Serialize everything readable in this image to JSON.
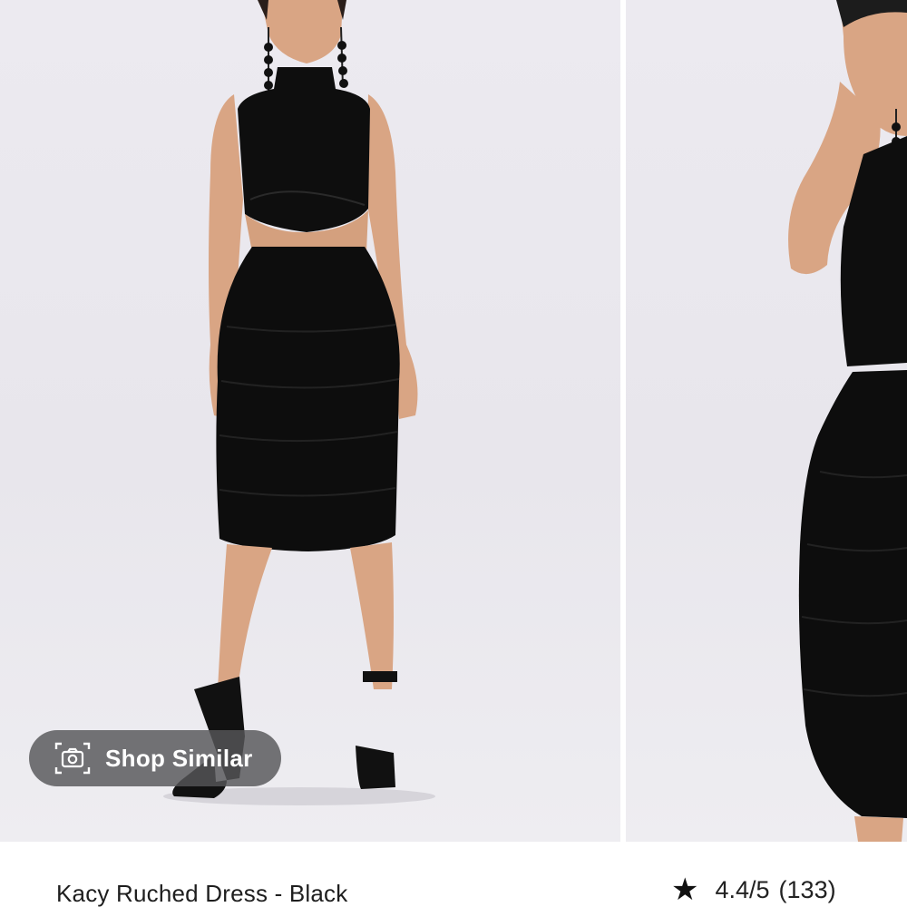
{
  "gallery": {
    "images": [
      {
        "alt": "model-front-view-icon"
      },
      {
        "alt": "model-side-view-icon"
      }
    ],
    "shop_similar": {
      "label": "Shop Similar",
      "icon": "camera-icon"
    }
  },
  "product": {
    "name": "Kacy Ruched Dress - Black",
    "rating": {
      "icon": "star-icon",
      "score": "4.4/5",
      "count": "(133)"
    }
  },
  "colors": {
    "background": "#e9e8ed",
    "garment": "#0d0d0d",
    "skin": "#d9a584",
    "pill": "#555558"
  }
}
